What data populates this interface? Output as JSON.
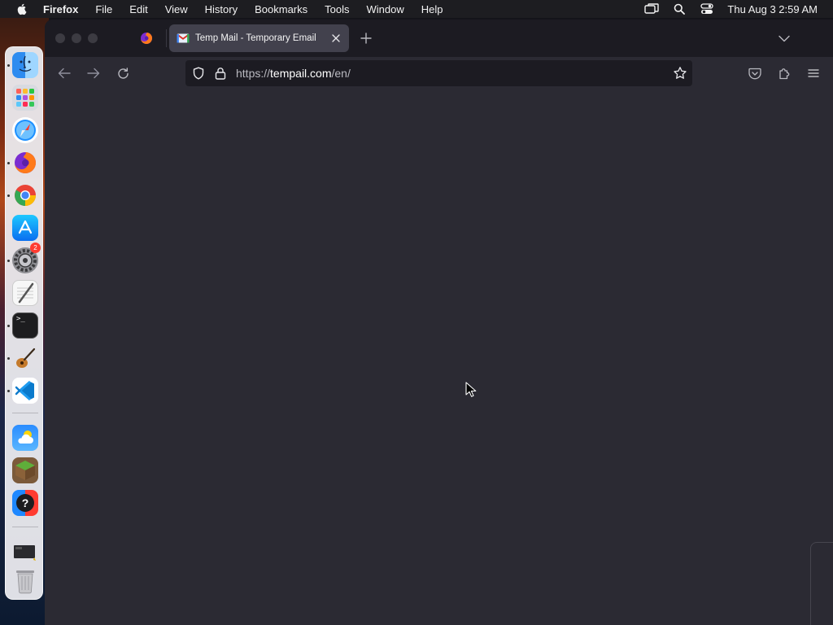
{
  "menubar": {
    "app_name": "Firefox",
    "menus": [
      "File",
      "Edit",
      "View",
      "History",
      "Bookmarks",
      "Tools",
      "Window",
      "Help"
    ],
    "clock": "Thu Aug 3  2:59 AM",
    "status_icons": [
      "screen-mirroring-icon",
      "spotlight-search-icon",
      "control-center-icon"
    ]
  },
  "browser": {
    "active_tab": {
      "title": "Temp Mail - Temporary Email",
      "favicon": "gmail-style-envelope-icon"
    },
    "pinned_tab_icon": "firefox-icon",
    "url": {
      "prefix": "https://",
      "host": "tempail.com",
      "path": "/en/"
    },
    "colors": {
      "toolbar": "#2b2a33",
      "tabbar": "#1c1b22",
      "active_tab": "#42414d",
      "content": "#2b2a33"
    }
  },
  "dock": {
    "apps": [
      {
        "name": "Finder",
        "icon": "finder-icon",
        "running": true
      },
      {
        "name": "Launchpad",
        "icon": "launchpad-icon",
        "running": false
      },
      {
        "name": "Safari",
        "icon": "safari-icon",
        "running": false
      },
      {
        "name": "Firefox",
        "icon": "firefox-icon",
        "running": true
      },
      {
        "name": "Google Chrome",
        "icon": "chrome-icon",
        "running": true
      },
      {
        "name": "App Store",
        "icon": "app-store-icon",
        "running": false
      },
      {
        "name": "System Settings",
        "icon": "settings-gear-icon",
        "running": true,
        "badge": "2"
      },
      {
        "name": "TextEdit",
        "icon": "textedit-icon",
        "running": false
      },
      {
        "name": "Terminal",
        "icon": "terminal-icon",
        "running": true
      },
      {
        "name": "GarageBand",
        "icon": "guitar-icon",
        "running": true
      },
      {
        "name": "Visual Studio Code",
        "icon": "vscode-icon",
        "running": true
      },
      {
        "name": "Weather",
        "icon": "weather-icon",
        "running": false
      },
      {
        "name": "Minecraft",
        "icon": "minecraft-grass-block-icon",
        "running": false
      },
      {
        "name": "Help",
        "icon": "help-question-icon",
        "running": false
      },
      {
        "name": "Downloads",
        "icon": "downloads-stack-icon",
        "running": false
      },
      {
        "name": "Trash",
        "icon": "trash-icon",
        "running": false
      }
    ],
    "terminal_glyph": ">_",
    "help_glyph": "?"
  }
}
